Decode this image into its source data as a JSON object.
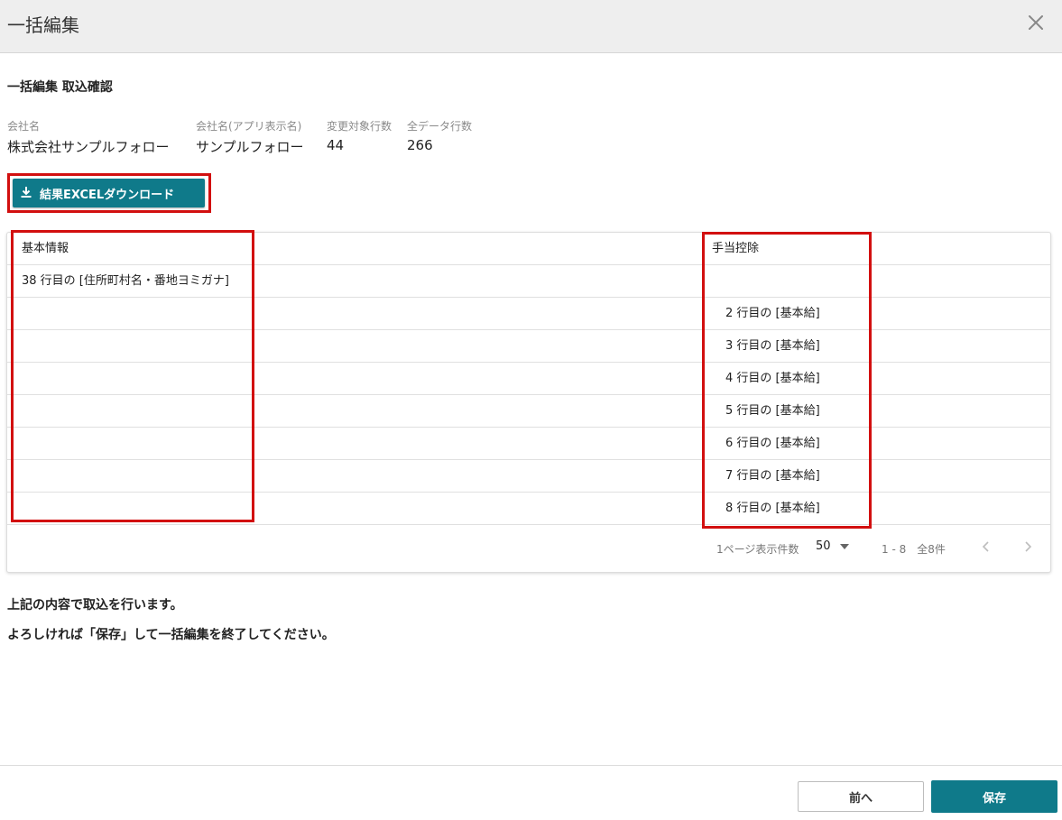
{
  "dialog": {
    "title": "一括編集",
    "close_icon": "close-icon"
  },
  "section": {
    "title": "一括編集 取込確認"
  },
  "info": [
    {
      "label": "会社名",
      "value": "株式会社サンプルフォロー"
    },
    {
      "label": "会社名(アプリ表示名)",
      "value": "サンプルフォロー"
    },
    {
      "label": "変更対象行数",
      "value": "44"
    },
    {
      "label": "全データ行数",
      "value": "266"
    }
  ],
  "download": {
    "label": "結果EXCELダウンロード",
    "icon": "download-icon"
  },
  "table": {
    "headers": [
      "基本情報",
      "手当控除"
    ],
    "rows": [
      {
        "col1": "38 行目の [住所町村名・番地ヨミガナ]",
        "col2": ""
      },
      {
        "col1": "",
        "col2": "2 行目の [基本給]"
      },
      {
        "col1": "",
        "col2": "3 行目の [基本給]"
      },
      {
        "col1": "",
        "col2": "4 行目の [基本給]"
      },
      {
        "col1": "",
        "col2": "5 行目の [基本給]"
      },
      {
        "col1": "",
        "col2": "6 行目の [基本給]"
      },
      {
        "col1": "",
        "col2": "7 行目の [基本給]"
      },
      {
        "col1": "",
        "col2": "8 行目の [基本給]"
      }
    ]
  },
  "pagination": {
    "per_page_label": "1ページ表示件数",
    "per_page_value": "50",
    "range": "1 - 8　全8件",
    "prev_icon": "chevron-left-icon",
    "next_icon": "chevron-right-icon"
  },
  "message": {
    "line1": "上記の内容で取込を行います。",
    "line2": "よろしければ「保存」して一括編集を終了してください。"
  },
  "footer": {
    "back_label": "前へ",
    "save_label": "保存"
  },
  "colors": {
    "accent": "#0f7a8a",
    "highlight": "#d20f0f"
  }
}
